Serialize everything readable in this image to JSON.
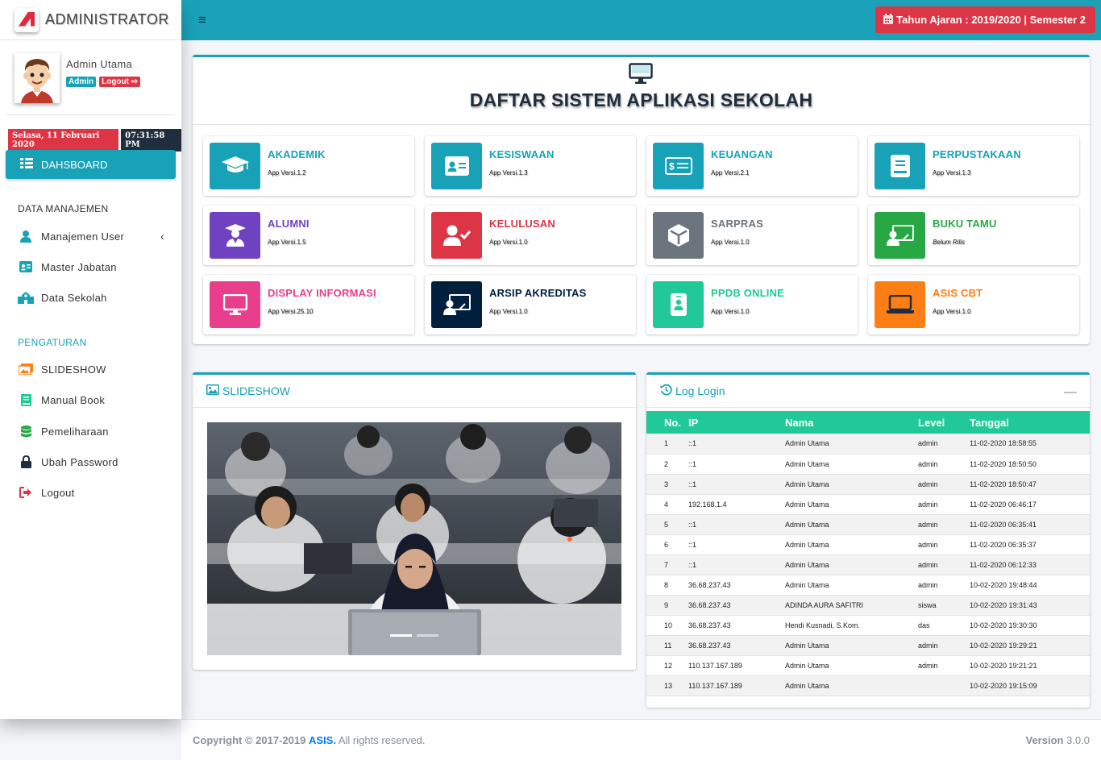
{
  "brand": {
    "title": "ADMINISTRATOR"
  },
  "user": {
    "name": "Admin Utama",
    "role_badge": "Admin",
    "logout_badge": "Logout"
  },
  "datetime": {
    "date": "Selasa, 11 Februari 2020",
    "time": "07:31:58 PM"
  },
  "nav": {
    "dashboard": "DAHSBOARD",
    "section_data": "DATA MANAJEMEN",
    "manajemen_user": "Manajemen User",
    "master_jabatan": "Master Jabatan",
    "data_sekolah": "Data Sekolah",
    "section_settings": "PENGATURAN",
    "slideshow": "SLIDESHOW",
    "manual_book": "Manual Book",
    "pemeliharaan": "Pemeliharaan",
    "ubah_password": "Ubah Password",
    "logout": "Logout"
  },
  "topbar": {
    "year_label": "Tahun Ajaran : 2019/2020 | Semester 2"
  },
  "main": {
    "title": "DAFTAR SISTEM APLIKASI SEKOLAH",
    "apps": [
      {
        "name": "AKADEMIK",
        "version": "App Versi.1.2",
        "color": "#17a2b8",
        "icon": "graduation-cap-icon"
      },
      {
        "name": "KESISWAAN",
        "version": "App Versi.1.3",
        "color": "#17a2b8",
        "icon": "id-card-icon"
      },
      {
        "name": "KEUANGAN",
        "version": "App Versi.2.1",
        "color": "#17a2b8",
        "icon": "money-card-icon"
      },
      {
        "name": "PERPUSTAKAAN",
        "version": "App Versi.1.3",
        "color": "#17a2b8",
        "icon": "book-icon"
      },
      {
        "name": "ALUMNI",
        "version": "App Versi.1.5",
        "color": "#6f42c1",
        "icon": "graduate-user-icon"
      },
      {
        "name": "KELULUSAN",
        "version": "App Versi.1.0",
        "color": "#dc3545",
        "icon": "user-check-icon"
      },
      {
        "name": "SARPRAS",
        "version": "App Versi.1.0",
        "color": "#6c757d",
        "icon": "box-icon"
      },
      {
        "name": "BUKU TAMU",
        "version": "Belum Rilis",
        "color": "#28a745",
        "icon": "chalkboard-user-icon"
      },
      {
        "name": "DISPLAY INFORMASI",
        "version": "App Versi.25.10",
        "color": "#e83e8c",
        "icon": "desktop-icon"
      },
      {
        "name": "ARSIP AKREDITAS",
        "version": "App Versi.1.0",
        "color": "#001f3f",
        "icon": "chalkboard-user-icon"
      },
      {
        "name": "PPDB ONLINE",
        "version": "App Versi.1.0",
        "color": "#20c997",
        "icon": "mobile-user-icon"
      },
      {
        "name": "ASIS CBT",
        "version": "App Versi.1.0",
        "color": "#fd7e14",
        "icon": "laptop-icon"
      }
    ]
  },
  "slideshow": {
    "title": "SLIDESHOW"
  },
  "log": {
    "title": "Log Login",
    "headers": [
      "No.",
      "IP",
      "Nama",
      "Level",
      "Tanggal"
    ],
    "rows": [
      [
        "1",
        "::1",
        "Admin Utama",
        "admin",
        "11-02-2020 18:58:55"
      ],
      [
        "2",
        "::1",
        "Admin Utama",
        "admin",
        "11-02-2020 18:50:50"
      ],
      [
        "3",
        "::1",
        "Admin Utama",
        "admin",
        "11-02-2020 18:50:47"
      ],
      [
        "4",
        "192.168.1.4",
        "Admin Utama",
        "admin",
        "11-02-2020 06:46:17"
      ],
      [
        "5",
        "::1",
        "Admin Utama",
        "admin",
        "11-02-2020 06:35:41"
      ],
      [
        "6",
        "::1",
        "Admin Utama",
        "admin",
        "11-02-2020 06:35:37"
      ],
      [
        "7",
        "::1",
        "Admin Utama",
        "admin",
        "11-02-2020 06:12:33"
      ],
      [
        "8",
        "36.68.237.43",
        "Admin Utama",
        "admin",
        "10-02-2020 19:48:44"
      ],
      [
        "9",
        "36.68.237.43",
        "ADINDA AURA SAFITRI",
        "siswa",
        "10-02-2020 19:31:43"
      ],
      [
        "10",
        "36.68.237.43",
        "Hendi Kusnadi, S.Kom.",
        "das",
        "10-02-2020 19:30:30"
      ],
      [
        "11",
        "36.68.237.43",
        "Admin Utama",
        "admin",
        "10-02-2020 19:29:21"
      ],
      [
        "12",
        "110.137.167.189",
        "Admin Utama",
        "admin",
        "10-02-2020 19:21:21"
      ],
      [
        "13",
        "110.137.167.189",
        "Admin Utama",
        "",
        "10-02-2020 19:15:09"
      ]
    ]
  },
  "footer": {
    "copyright": "Copyright © 2017-2019",
    "brand": "ASIS.",
    "rights": "All rights reserved.",
    "version_label": "Version",
    "version": "3.0.0"
  }
}
